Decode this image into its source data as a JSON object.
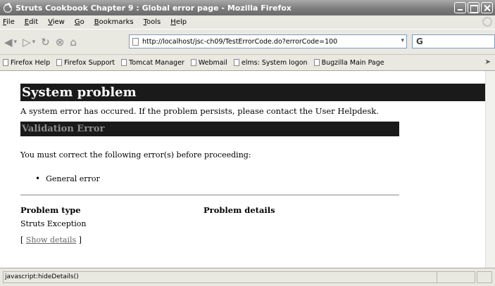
{
  "window": {
    "title": "Struts Cookbook Chapter 9 : Global error page - Mozilla Firefox"
  },
  "menu": [
    {
      "ul": "F",
      "rest": "ile"
    },
    {
      "ul": "E",
      "rest": "dit"
    },
    {
      "ul": "V",
      "rest": "iew"
    },
    {
      "ul": "G",
      "rest": "o"
    },
    {
      "ul": "B",
      "rest": "ookmarks"
    },
    {
      "ul": "T",
      "rest": "ools"
    },
    {
      "ul": "H",
      "rest": "elp"
    }
  ],
  "nav": {
    "url": "http://localhost/jsc-ch09/TestErrorCode.do?errorCode=100",
    "search_value": "G"
  },
  "bookmarks": [
    "Firefox Help",
    "Firefox Support",
    "Tomcat Manager",
    "Webmail",
    "elms: System logon",
    "Bugzilla Main Page"
  ],
  "page": {
    "heading": "System problem",
    "intro": "A system error has occured. If the problem persists, please contact the User Helpdesk.",
    "validation_heading": "Validation Error",
    "correct_text": "You must correct the following error(s) before proceeding:",
    "errors": [
      "General error"
    ],
    "problem_type_label": "Problem type",
    "problem_details_label": "Problem details",
    "problem_type_value": "Struts Exception",
    "show_details_open": "[ ",
    "show_details_link": "Show details",
    "show_details_close": " ]"
  },
  "status": {
    "text": "javascript:hideDetails()"
  },
  "colors": {
    "heading_bg": "#1a1a1a",
    "validation_text": "#8e8e8e"
  }
}
